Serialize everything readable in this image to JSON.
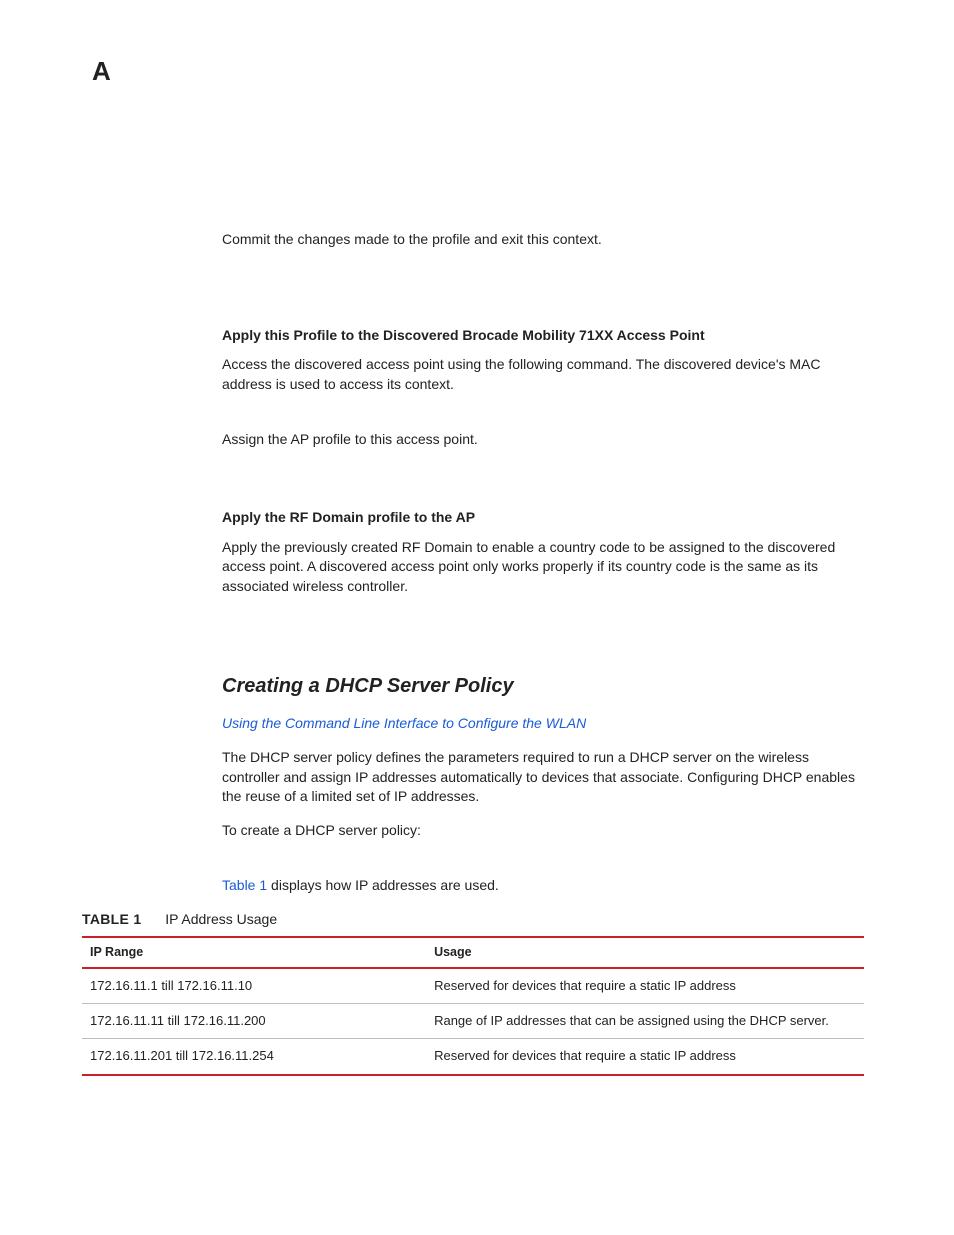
{
  "appendix_letter": "A",
  "intro_para": "Commit the changes made to the profile and exit this context.",
  "sec1": {
    "heading": "Apply this Profile to the Discovered Brocade Mobility 71XX Access Point",
    "para": "Access the discovered access point using the following command. The discovered device's MAC address is used to access its context.",
    "para2": "Assign the AP profile to this access point."
  },
  "sec2": {
    "heading": "Apply the RF Domain profile to the AP",
    "para": "Apply the previously created RF Domain to enable a country code to be assigned to the discovered access point. A discovered access point only works properly if its country code is the same as its associated wireless controller."
  },
  "sec3": {
    "title": "Creating a DHCP Server Policy",
    "link": "Using the Command Line Interface to Configure the WLAN",
    "para1": "The DHCP server policy defines the parameters required to run a DHCP server on the wireless controller and assign IP addresses automatically to devices that associate. Configuring DHCP enables the reuse of a limited set of IP addresses.",
    "para2": "To create a DHCP server policy:",
    "table_intro_link": "Table 1",
    "table_intro_rest": " displays how IP addresses are used."
  },
  "table": {
    "label": "TABLE 1",
    "caption": "IP Address Usage",
    "headers": {
      "c0": "IP Range",
      "c1": "Usage"
    },
    "rows": [
      {
        "c0": "172.16.11.1 till 172.16.11.10",
        "c1": "Reserved for devices that require a static IP address"
      },
      {
        "c0": "172.16.11.11 till 172.16.11.200",
        "c1": "Range of IP addresses that can be assigned using the DHCP server."
      },
      {
        "c0": "172.16.11.201 till 172.16.11.254",
        "c1": "Reserved for devices that require a static IP address"
      }
    ]
  }
}
